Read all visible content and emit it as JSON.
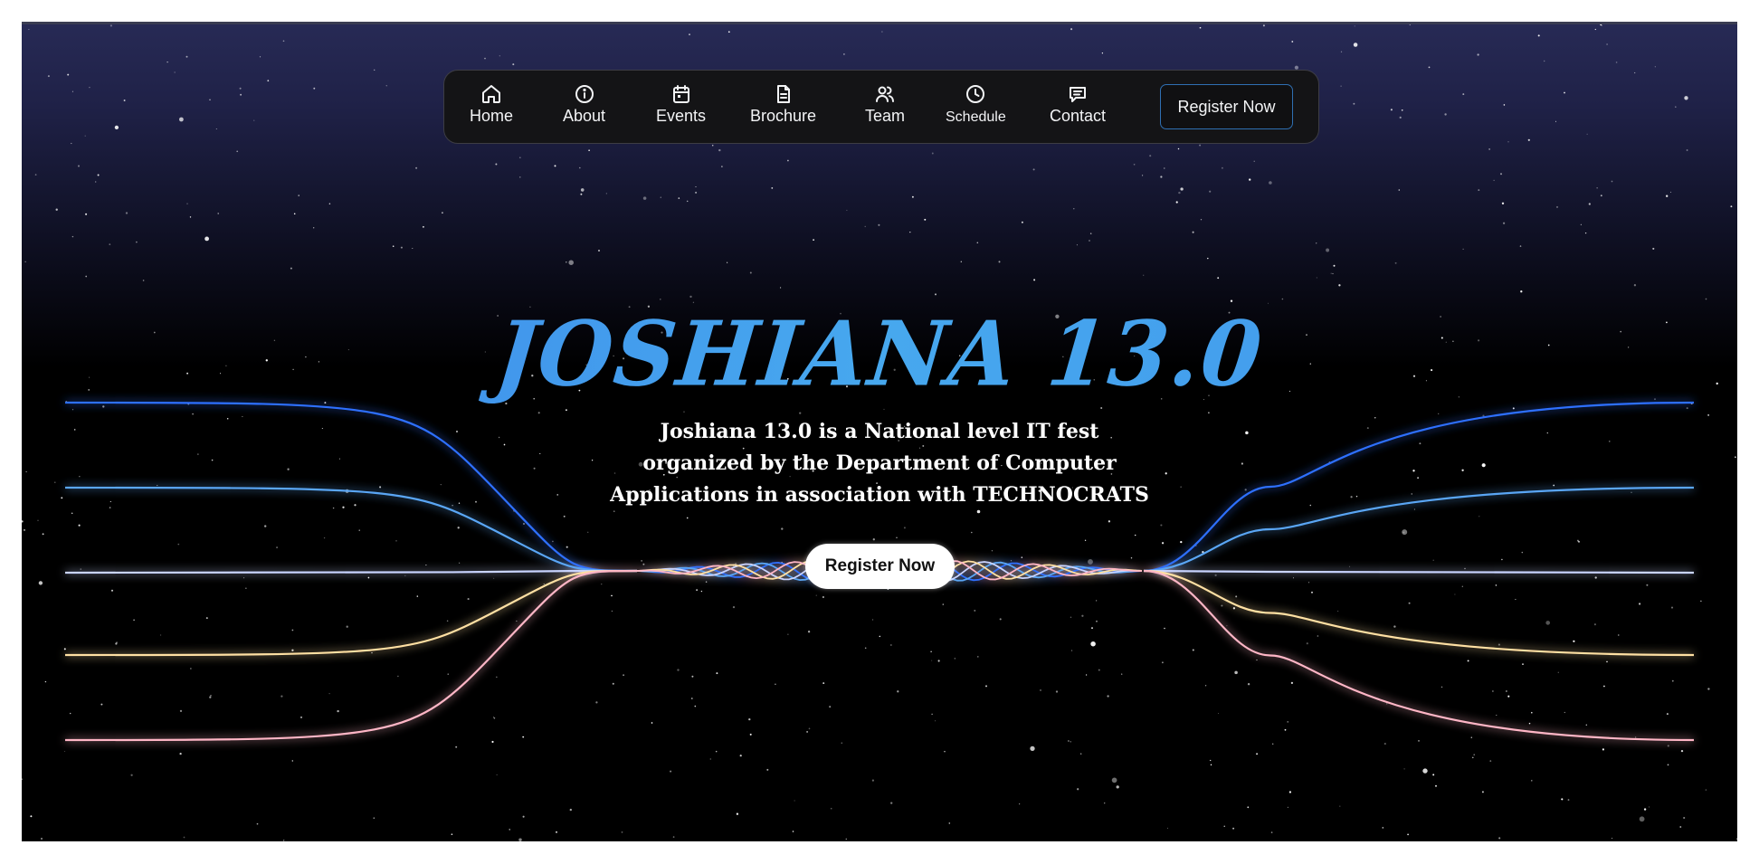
{
  "nav": {
    "items": [
      {
        "label": "Home",
        "icon": "home-icon"
      },
      {
        "label": "About",
        "icon": "info-icon"
      },
      {
        "label": "Events",
        "icon": "calendar-icon"
      },
      {
        "label": "Brochure",
        "icon": "document-icon"
      },
      {
        "label": "Team",
        "icon": "users-icon"
      },
      {
        "label": "Schedule",
        "icon": "clock-icon"
      },
      {
        "label": "Contact",
        "icon": "message-icon"
      }
    ],
    "register_label": "Register Now"
  },
  "hero": {
    "title": "JOSHIANA 13.0",
    "description": "Joshiana 13.0 is a National level IT fest organized by the Department of Computer Applications in association with TECHNOCRATS",
    "cta_label": "Register Now"
  },
  "colors": {
    "background_top": "#272a55",
    "background_bottom": "#000000",
    "title_gradient": [
      "#3a82ea",
      "#47a8ee"
    ],
    "wave_colors": [
      "#2f6fff",
      "#5aa6f5",
      "#c9d4ff",
      "#ffe0a3",
      "#ffb6c6"
    ],
    "register_border": "#2f6fb2"
  }
}
